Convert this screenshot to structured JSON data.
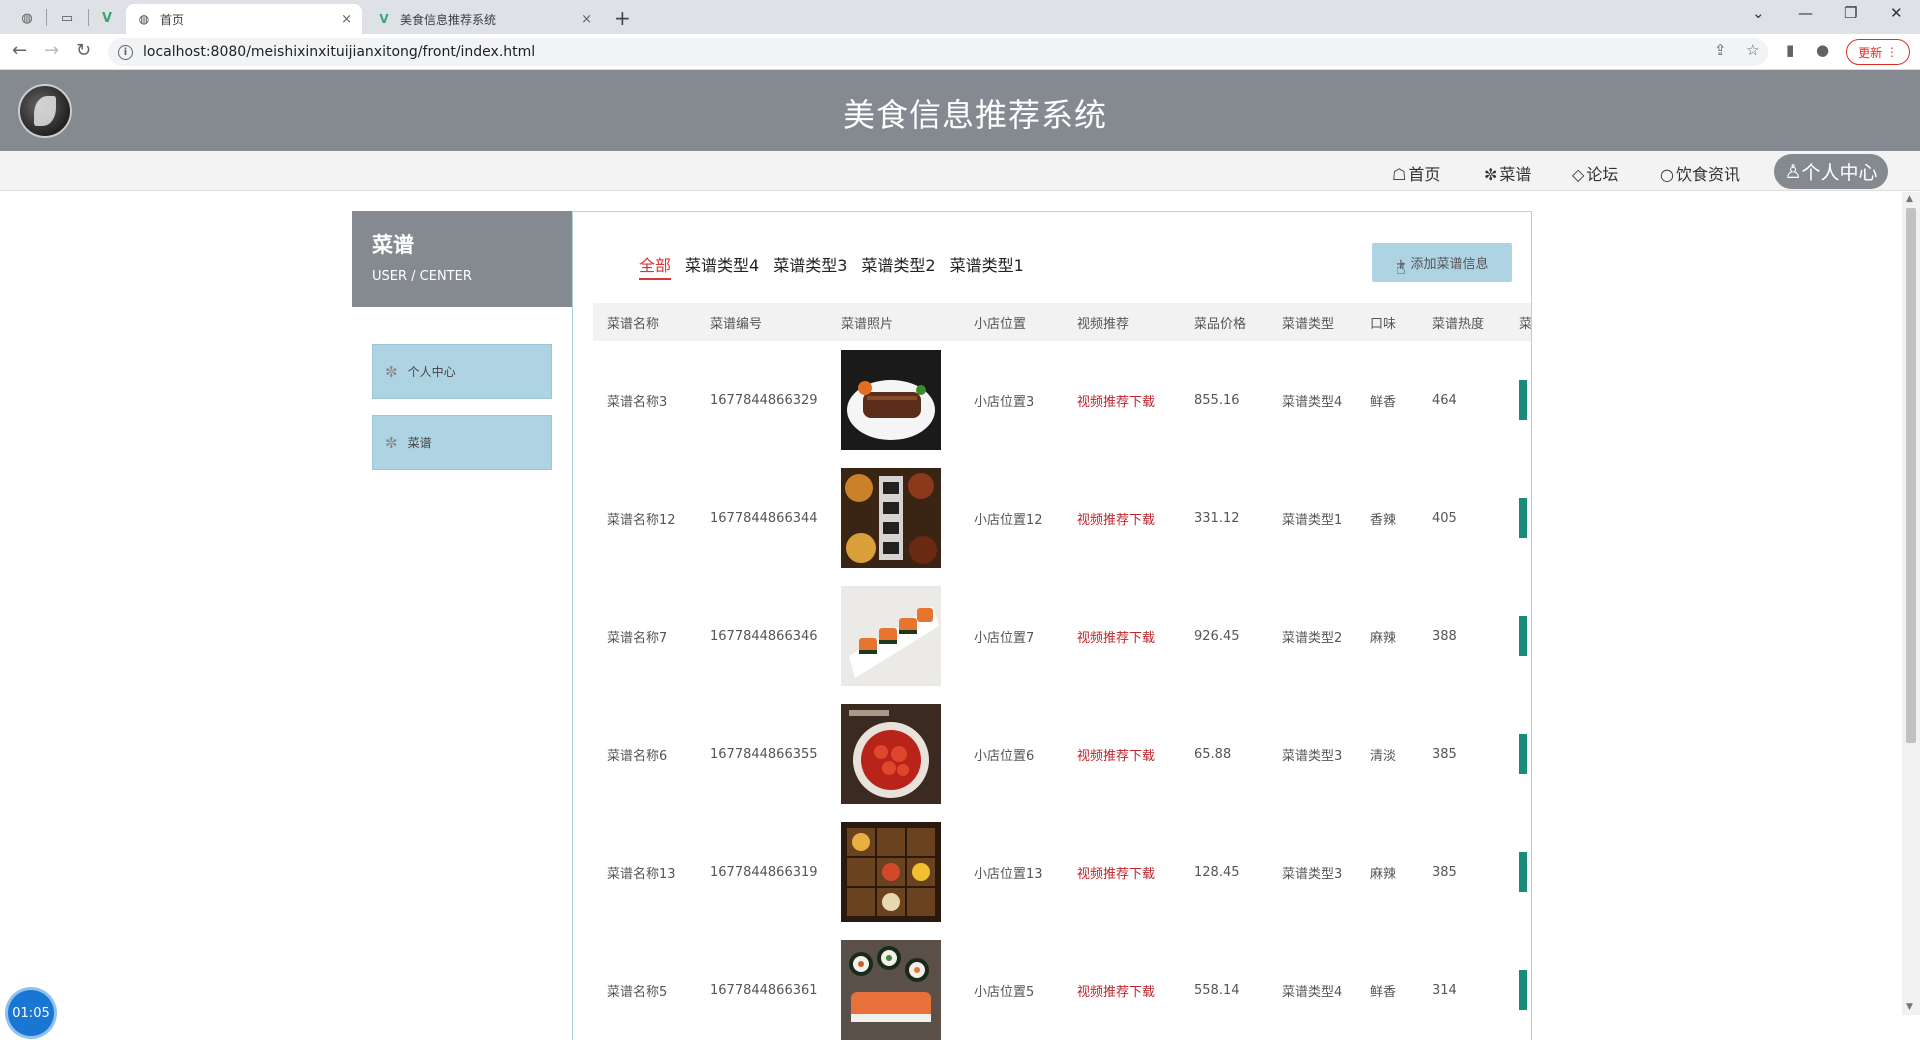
{
  "browser": {
    "tabs": [
      {
        "title": "首页",
        "close": "×"
      },
      {
        "title": "美食信息推荐系统",
        "close": "×"
      }
    ],
    "new_tab": "+",
    "url": "localhost:8080/meishixinxituijianxitong/front/index.html",
    "update_label": "更新"
  },
  "site": {
    "title": "美食信息推荐系统",
    "nav": [
      {
        "icon": "☖",
        "label": "首页"
      },
      {
        "icon": "✼",
        "label": "菜谱"
      },
      {
        "icon": "◇",
        "label": "论坛"
      },
      {
        "icon": "○",
        "label": "饮食资讯"
      }
    ],
    "center_label": "个人中心"
  },
  "sidebar": {
    "title": "菜谱",
    "subtitle": "USER / CENTER",
    "items": [
      {
        "label": "个人中心"
      },
      {
        "label": "菜谱"
      }
    ]
  },
  "main": {
    "filters": [
      "全部",
      "菜谱类型4",
      "菜谱类型3",
      "菜谱类型2",
      "菜谱类型1"
    ],
    "add_button": "+ 添加菜谱信息",
    "columns": [
      "菜谱名称",
      "菜谱编号",
      "菜谱照片",
      "小店位置",
      "视频推荐",
      "菜品价格",
      "菜谱类型",
      "口味",
      "菜谱热度",
      "菜"
    ],
    "rows": [
      {
        "name": "菜谱名称3",
        "code": "1677844866329",
        "photo": "steak",
        "location": "小店位置3",
        "video": "视频推荐下载",
        "price": "855.16",
        "type": "菜谱类型4",
        "taste": "鲜香",
        "heat": "464"
      },
      {
        "name": "菜谱名称12",
        "code": "1677844866344",
        "photo": "chengdu-snacks",
        "location": "小店位置12",
        "video": "视频推荐下载",
        "price": "331.12",
        "type": "菜谱类型1",
        "taste": "香辣",
        "heat": "405"
      },
      {
        "name": "菜谱名称7",
        "code": "1677844866346",
        "photo": "sushi-plate",
        "location": "小店位置7",
        "video": "视频推荐下载",
        "price": "926.45",
        "type": "菜谱类型2",
        "taste": "麻辣",
        "heat": "388"
      },
      {
        "name": "菜谱名称6",
        "code": "1677844866355",
        "photo": "crayfish",
        "location": "小店位置6",
        "video": "视频推荐下载",
        "price": "65.88",
        "type": "菜谱类型3",
        "taste": "清淡",
        "heat": "385"
      },
      {
        "name": "菜谱名称13",
        "code": "1677844866319",
        "photo": "bento-box",
        "location": "小店位置13",
        "video": "视频推荐下载",
        "price": "128.45",
        "type": "菜谱类型3",
        "taste": "麻辣",
        "heat": "385"
      },
      {
        "name": "菜谱名称5",
        "code": "1677844866361",
        "photo": "sushi-rolls",
        "location": "小店位置5",
        "video": "视频推荐下载",
        "price": "558.14",
        "type": "菜谱类型4",
        "taste": "鲜香",
        "heat": "314"
      }
    ]
  },
  "timer": "01:05"
}
